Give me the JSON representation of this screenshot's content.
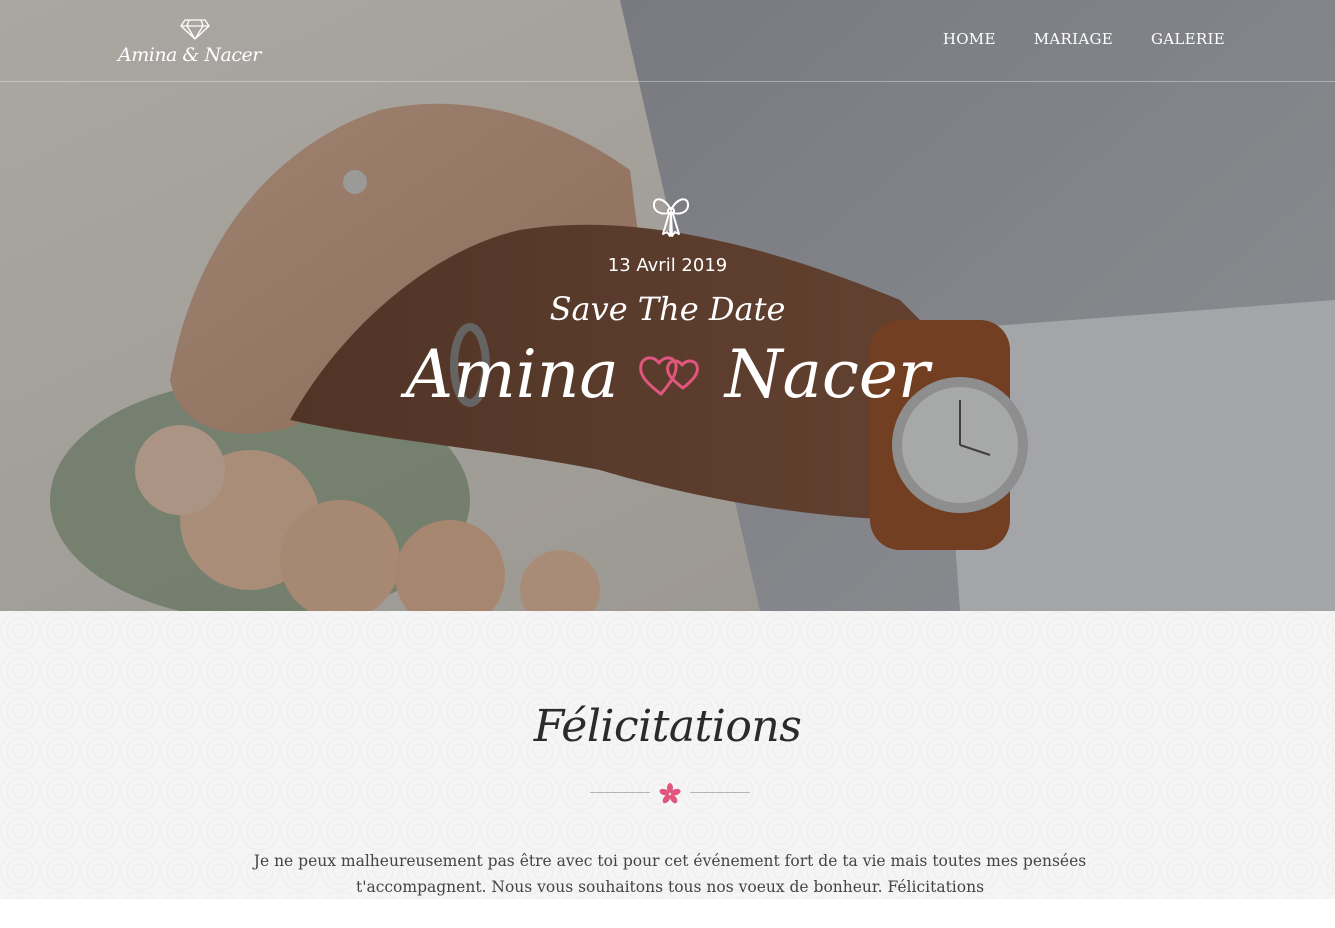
{
  "brand": {
    "logo_text": "Amina & Nacer",
    "logo_icon": "diamond-icon"
  },
  "nav": {
    "items": [
      {
        "label": "HOME"
      },
      {
        "label": "MARIAGE"
      },
      {
        "label": "GALERIE"
      }
    ]
  },
  "hero": {
    "icon": "bow-icon",
    "date": "13 Avril 2019",
    "subtitle": "Save The Date",
    "name_left": "Amina",
    "name_right": "Nacer",
    "separator_icon": "double-hearts-icon"
  },
  "section": {
    "title": "Félicitations",
    "divider_icon": "flower-icon",
    "text": "Je ne peux malheureusement pas être avec toi pour cet événement fort de ta vie mais toutes mes pensées t'accompagnent. Nous vous souhaitons tous nos voeux de bonheur. Félicitations"
  },
  "colors": {
    "accent": "#e0567e",
    "title_text": "#2b2b2b",
    "body_text": "#444444",
    "section_bg": "#f6f5f5"
  }
}
